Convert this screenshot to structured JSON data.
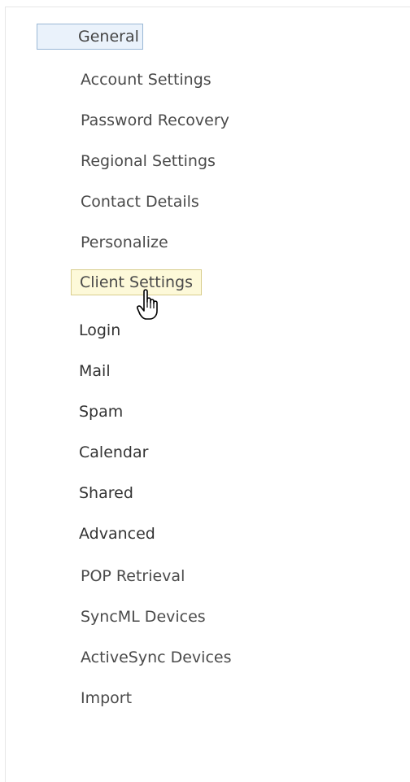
{
  "nav": {
    "items": [
      {
        "label": "General",
        "state": "selected"
      },
      {
        "label": "Account Settings"
      },
      {
        "label": "Password Recovery"
      },
      {
        "label": "Regional Settings"
      },
      {
        "label": "Contact Details"
      },
      {
        "label": "Personalize"
      },
      {
        "label": "Client Settings",
        "state": "hover"
      },
      {
        "label": "Login"
      },
      {
        "label": "Mail"
      },
      {
        "label": "Spam"
      },
      {
        "label": "Calendar"
      },
      {
        "label": "Shared"
      },
      {
        "label": "Advanced"
      },
      {
        "label": "POP Retrieval"
      },
      {
        "label": "SyncML Devices"
      },
      {
        "label": "ActiveSync Devices"
      },
      {
        "label": "Import"
      }
    ]
  },
  "cursor": {
    "icon": "hand-pointer-icon"
  },
  "colors": {
    "selected_bg": "#eaf2fb",
    "selected_border": "#9ab8d6",
    "hover_bg": "#fdf9d9",
    "hover_border": "#d8cd8c",
    "text": "#444444"
  }
}
